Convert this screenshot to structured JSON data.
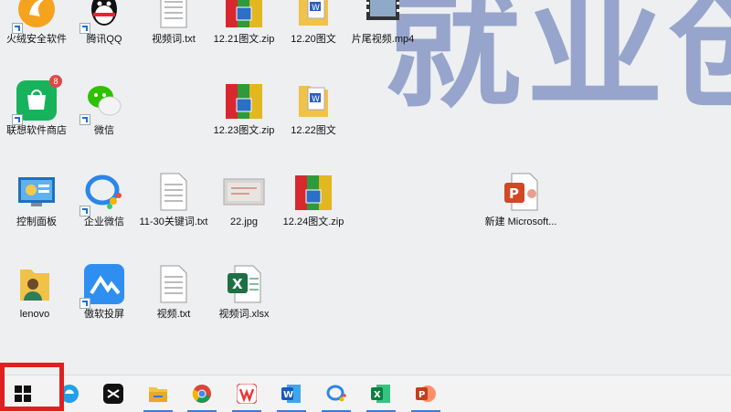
{
  "desktop": {
    "wallpaper_text": "就业创",
    "icons": [
      {
        "label": "火绒安全软件",
        "icon": "huorong-icon"
      },
      {
        "label": "腾讯QQ",
        "icon": "qq-icon"
      },
      {
        "label": "视频词.txt",
        "icon": "text-file-icon"
      },
      {
        "label": "12.21图文.zip",
        "icon": "zip-archive-icon"
      },
      {
        "label": "12.20图文",
        "icon": "word-folder-icon"
      },
      {
        "label": "片尾视频.mp4",
        "icon": "video-file-icon"
      },
      {
        "label": "联想软件商店",
        "icon": "lenovo-store-icon",
        "badge": "8"
      },
      {
        "label": "微信",
        "icon": "wechat-icon"
      },
      {
        "label": "12.23图文.zip",
        "icon": "zip-archive-icon"
      },
      {
        "label": "12.22图文",
        "icon": "word-folder-icon"
      },
      {
        "label": "控制面板",
        "icon": "control-panel-icon"
      },
      {
        "label": "企业微信",
        "icon": "wecom-icon"
      },
      {
        "label": "11-30关键词.txt",
        "icon": "text-file-icon"
      },
      {
        "label": "22.jpg",
        "icon": "image-file-icon"
      },
      {
        "label": "12.24图文.zip",
        "icon": "zip-archive-icon"
      },
      {
        "label": "新建 Microsoft...",
        "icon": "powerpoint-file-icon"
      },
      {
        "label": "lenovo",
        "icon": "user-folder-icon"
      },
      {
        "label": "傲软投屏",
        "icon": "apowermirror-icon"
      },
      {
        "label": "视频.txt",
        "icon": "text-file-icon"
      },
      {
        "label": "视频词.xlsx",
        "icon": "excel-file-icon"
      }
    ]
  },
  "taskbar": {
    "items": [
      {
        "name": "start-button",
        "icon": "windows-logo-icon"
      },
      {
        "name": "edge",
        "icon": "edge-icon"
      },
      {
        "name": "capcut",
        "icon": "capcut-icon"
      },
      {
        "name": "file-explorer",
        "icon": "folder-icon"
      },
      {
        "name": "chrome",
        "icon": "chrome-icon"
      },
      {
        "name": "wps",
        "icon": "wps-icon"
      },
      {
        "name": "word",
        "icon": "word-icon"
      },
      {
        "name": "wecom",
        "icon": "wecom-icon"
      },
      {
        "name": "excel",
        "icon": "excel-icon"
      },
      {
        "name": "powerpoint",
        "icon": "powerpoint-icon"
      }
    ]
  },
  "colors": {
    "accent": "#3a7bd5",
    "highlight": "#e02020"
  }
}
